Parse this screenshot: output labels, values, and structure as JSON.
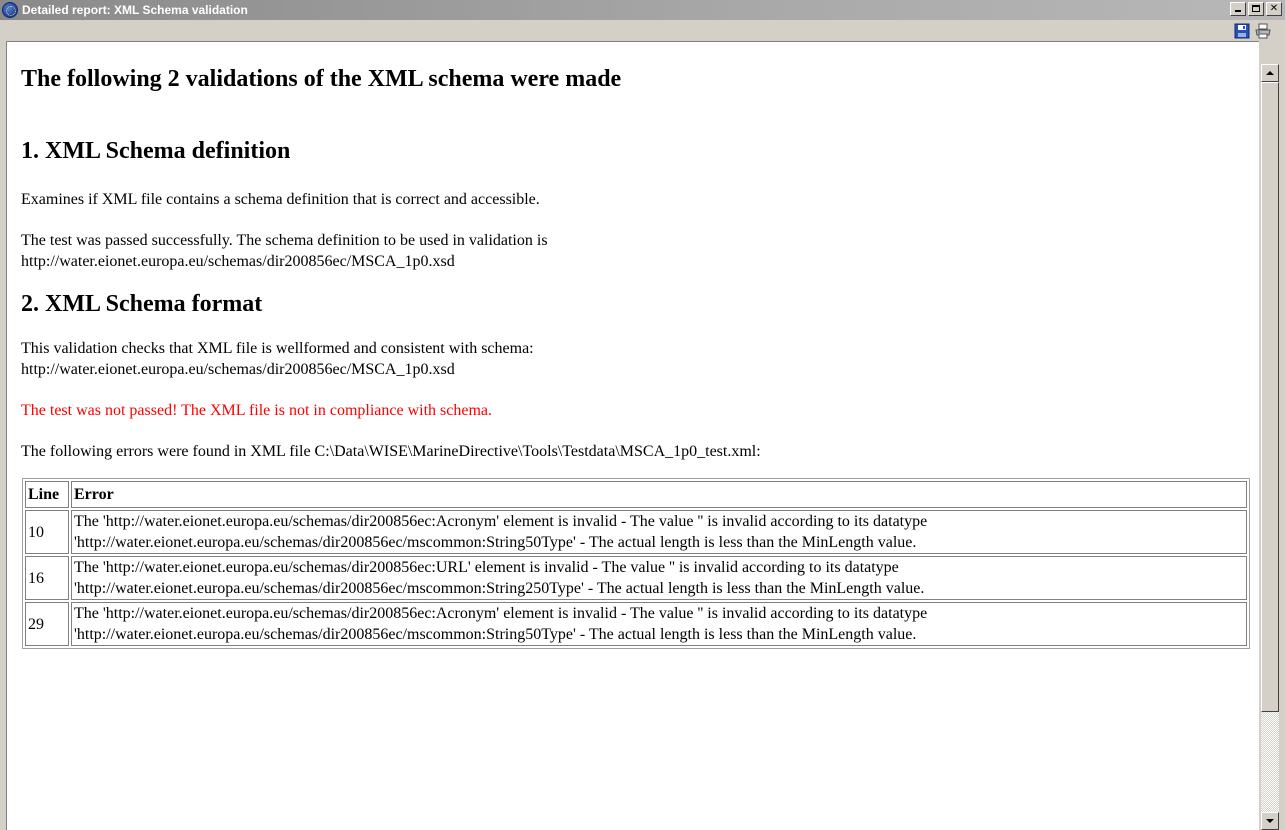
{
  "window": {
    "title": "Detailed report: XML Schema validation",
    "buttons": {
      "minimize": "_",
      "maximize": "□",
      "close": "✕"
    }
  },
  "toolbar": {
    "icons": [
      "save-icon",
      "print-icon"
    ]
  },
  "report": {
    "heading": "The following 2 validations of the XML schema were made",
    "section1": {
      "title": "1. XML Schema definition",
      "description": "Examines if XML file contains a schema definition that is correct and accessible.",
      "result_line1": "The test was passed successfully. The schema definition to be used in validation is",
      "result_line2": "http://water.eionet.europa.eu/schemas/dir200856ec/MSCA_1p0.xsd"
    },
    "section2": {
      "title": "2. XML Schema format",
      "description_line1": "This validation checks that XML file is wellformed and consistent with schema:",
      "description_line2": "http://water.eionet.europa.eu/schemas/dir200856ec/MSCA_1p0.xsd",
      "failure": "The test was not passed! The XML file is not in compliance with schema.",
      "errors_intro": "The following errors were found in XML file C:\\Data\\WISE\\MarineDirective\\Tools\\Testdata\\MSCA_1p0_test.xml:",
      "table": {
        "headers": {
          "line": "Line",
          "error": "Error"
        },
        "rows": [
          {
            "line": "10",
            "error_line1": "The 'http://water.eionet.europa.eu/schemas/dir200856ec:Acronym' element is invalid - The value '' is invalid according to its datatype",
            "error_line2": "'http://water.eionet.europa.eu/schemas/dir200856ec/mscommon:String50Type' - The actual length is less than the MinLength value."
          },
          {
            "line": "16",
            "error_line1": "The 'http://water.eionet.europa.eu/schemas/dir200856ec:URL' element is invalid - The value '' is invalid according to its datatype",
            "error_line2": "'http://water.eionet.europa.eu/schemas/dir200856ec/mscommon:String250Type' - The actual length is less than the MinLength value."
          },
          {
            "line": "29",
            "error_line1": "The 'http://water.eionet.europa.eu/schemas/dir200856ec:Acronym' element is invalid - The value '' is invalid according to its datatype",
            "error_line2": "'http://water.eionet.europa.eu/schemas/dir200856ec/mscommon:String50Type' - The actual length is less than the MinLength value."
          }
        ]
      }
    }
  },
  "colors": {
    "failure_text": "#ff0000",
    "titlebar": "#8a8a8a",
    "window_bg": "#d4d0c8"
  }
}
